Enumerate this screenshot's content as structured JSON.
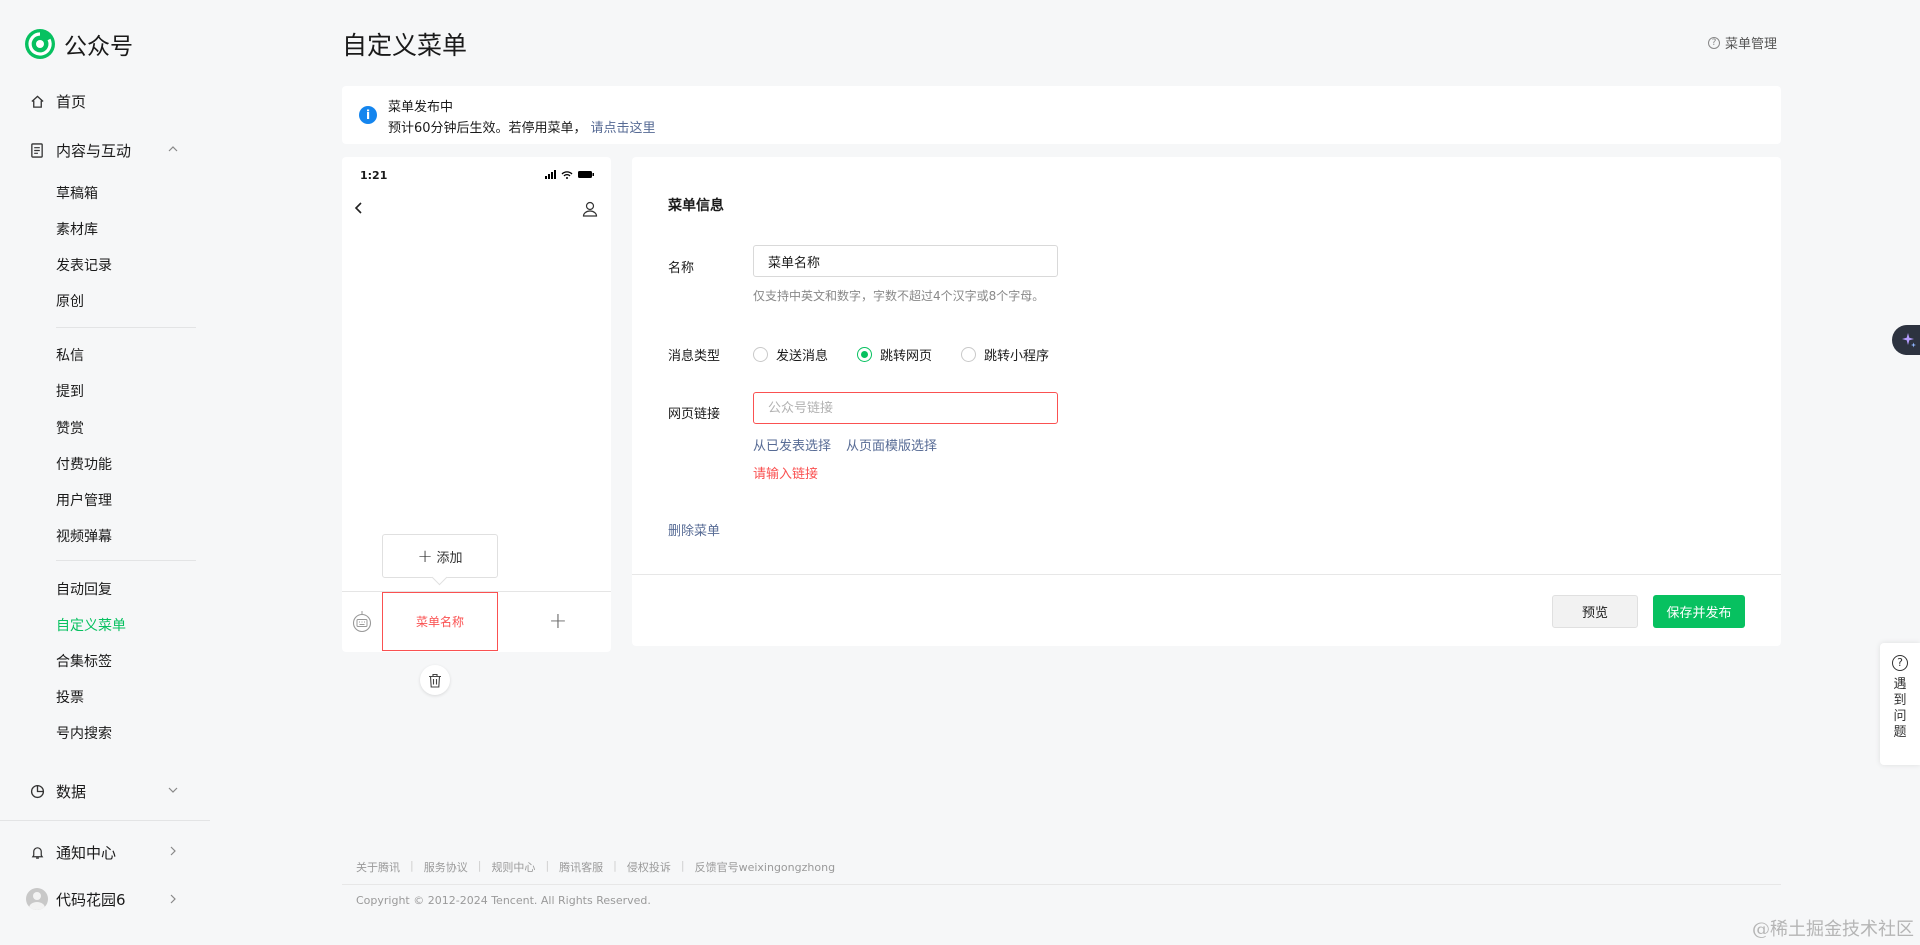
{
  "app": {
    "title": "公众号"
  },
  "sidebar": {
    "home": "首页",
    "content_group": "内容与互动",
    "content_items": [
      "草稿箱",
      "素材库",
      "发表记录",
      "原创"
    ],
    "interact_items": [
      "私信",
      "提到",
      "赞赏",
      "付费功能",
      "用户管理",
      "视频弹幕"
    ],
    "tool_items": [
      "自动回复",
      "自定义菜单",
      "合集标签",
      "投票",
      "号内搜索"
    ],
    "active_item": "自定义菜单",
    "data_group": "数据",
    "notice_center": "通知中心",
    "account_name": "代码花园6"
  },
  "header": {
    "page_title": "自定义菜单",
    "menu_management": "菜单管理"
  },
  "notice": {
    "title": "菜单发布中",
    "message": "预计60分钟后生效。若停用菜单，",
    "link": "请点击这里"
  },
  "phone": {
    "time": "1:21",
    "add_label": "添加",
    "menu_tab": "菜单名称",
    "add_tab": "+"
  },
  "form": {
    "section_title": "菜单信息",
    "name_label": "名称",
    "name_value": "菜单名称",
    "name_hint": "仅支持中英文和数字，字数不超过4个汉字或8个字母。",
    "type_label": "消息类型",
    "type_options": [
      "发送消息",
      "跳转网页",
      "跳转小程序"
    ],
    "type_selected": "跳转网页",
    "url_label": "网页链接",
    "url_placeholder": "公众号链接",
    "url_value": "",
    "select_published": "从已发表选择",
    "select_template": "从页面模版选择",
    "url_error": "请输入链接",
    "delete_menu": "删除菜单",
    "preview_button": "预览",
    "publish_button": "保存并发布"
  },
  "footer": {
    "links": [
      "关于腾讯",
      "服务协议",
      "规则中心",
      "腾讯客服",
      "侵权投诉",
      "反馈官号weixingongzhong"
    ],
    "copyright": "Copyright © 2012-2024 Tencent. All Rights Reserved."
  },
  "help_float": {
    "label": "遇到问题"
  },
  "watermark": "@稀土掘金技术社区",
  "colors": {
    "brand": "#07c160",
    "link": "#576b95",
    "error": "#fa5151",
    "info": "#1485ee"
  }
}
